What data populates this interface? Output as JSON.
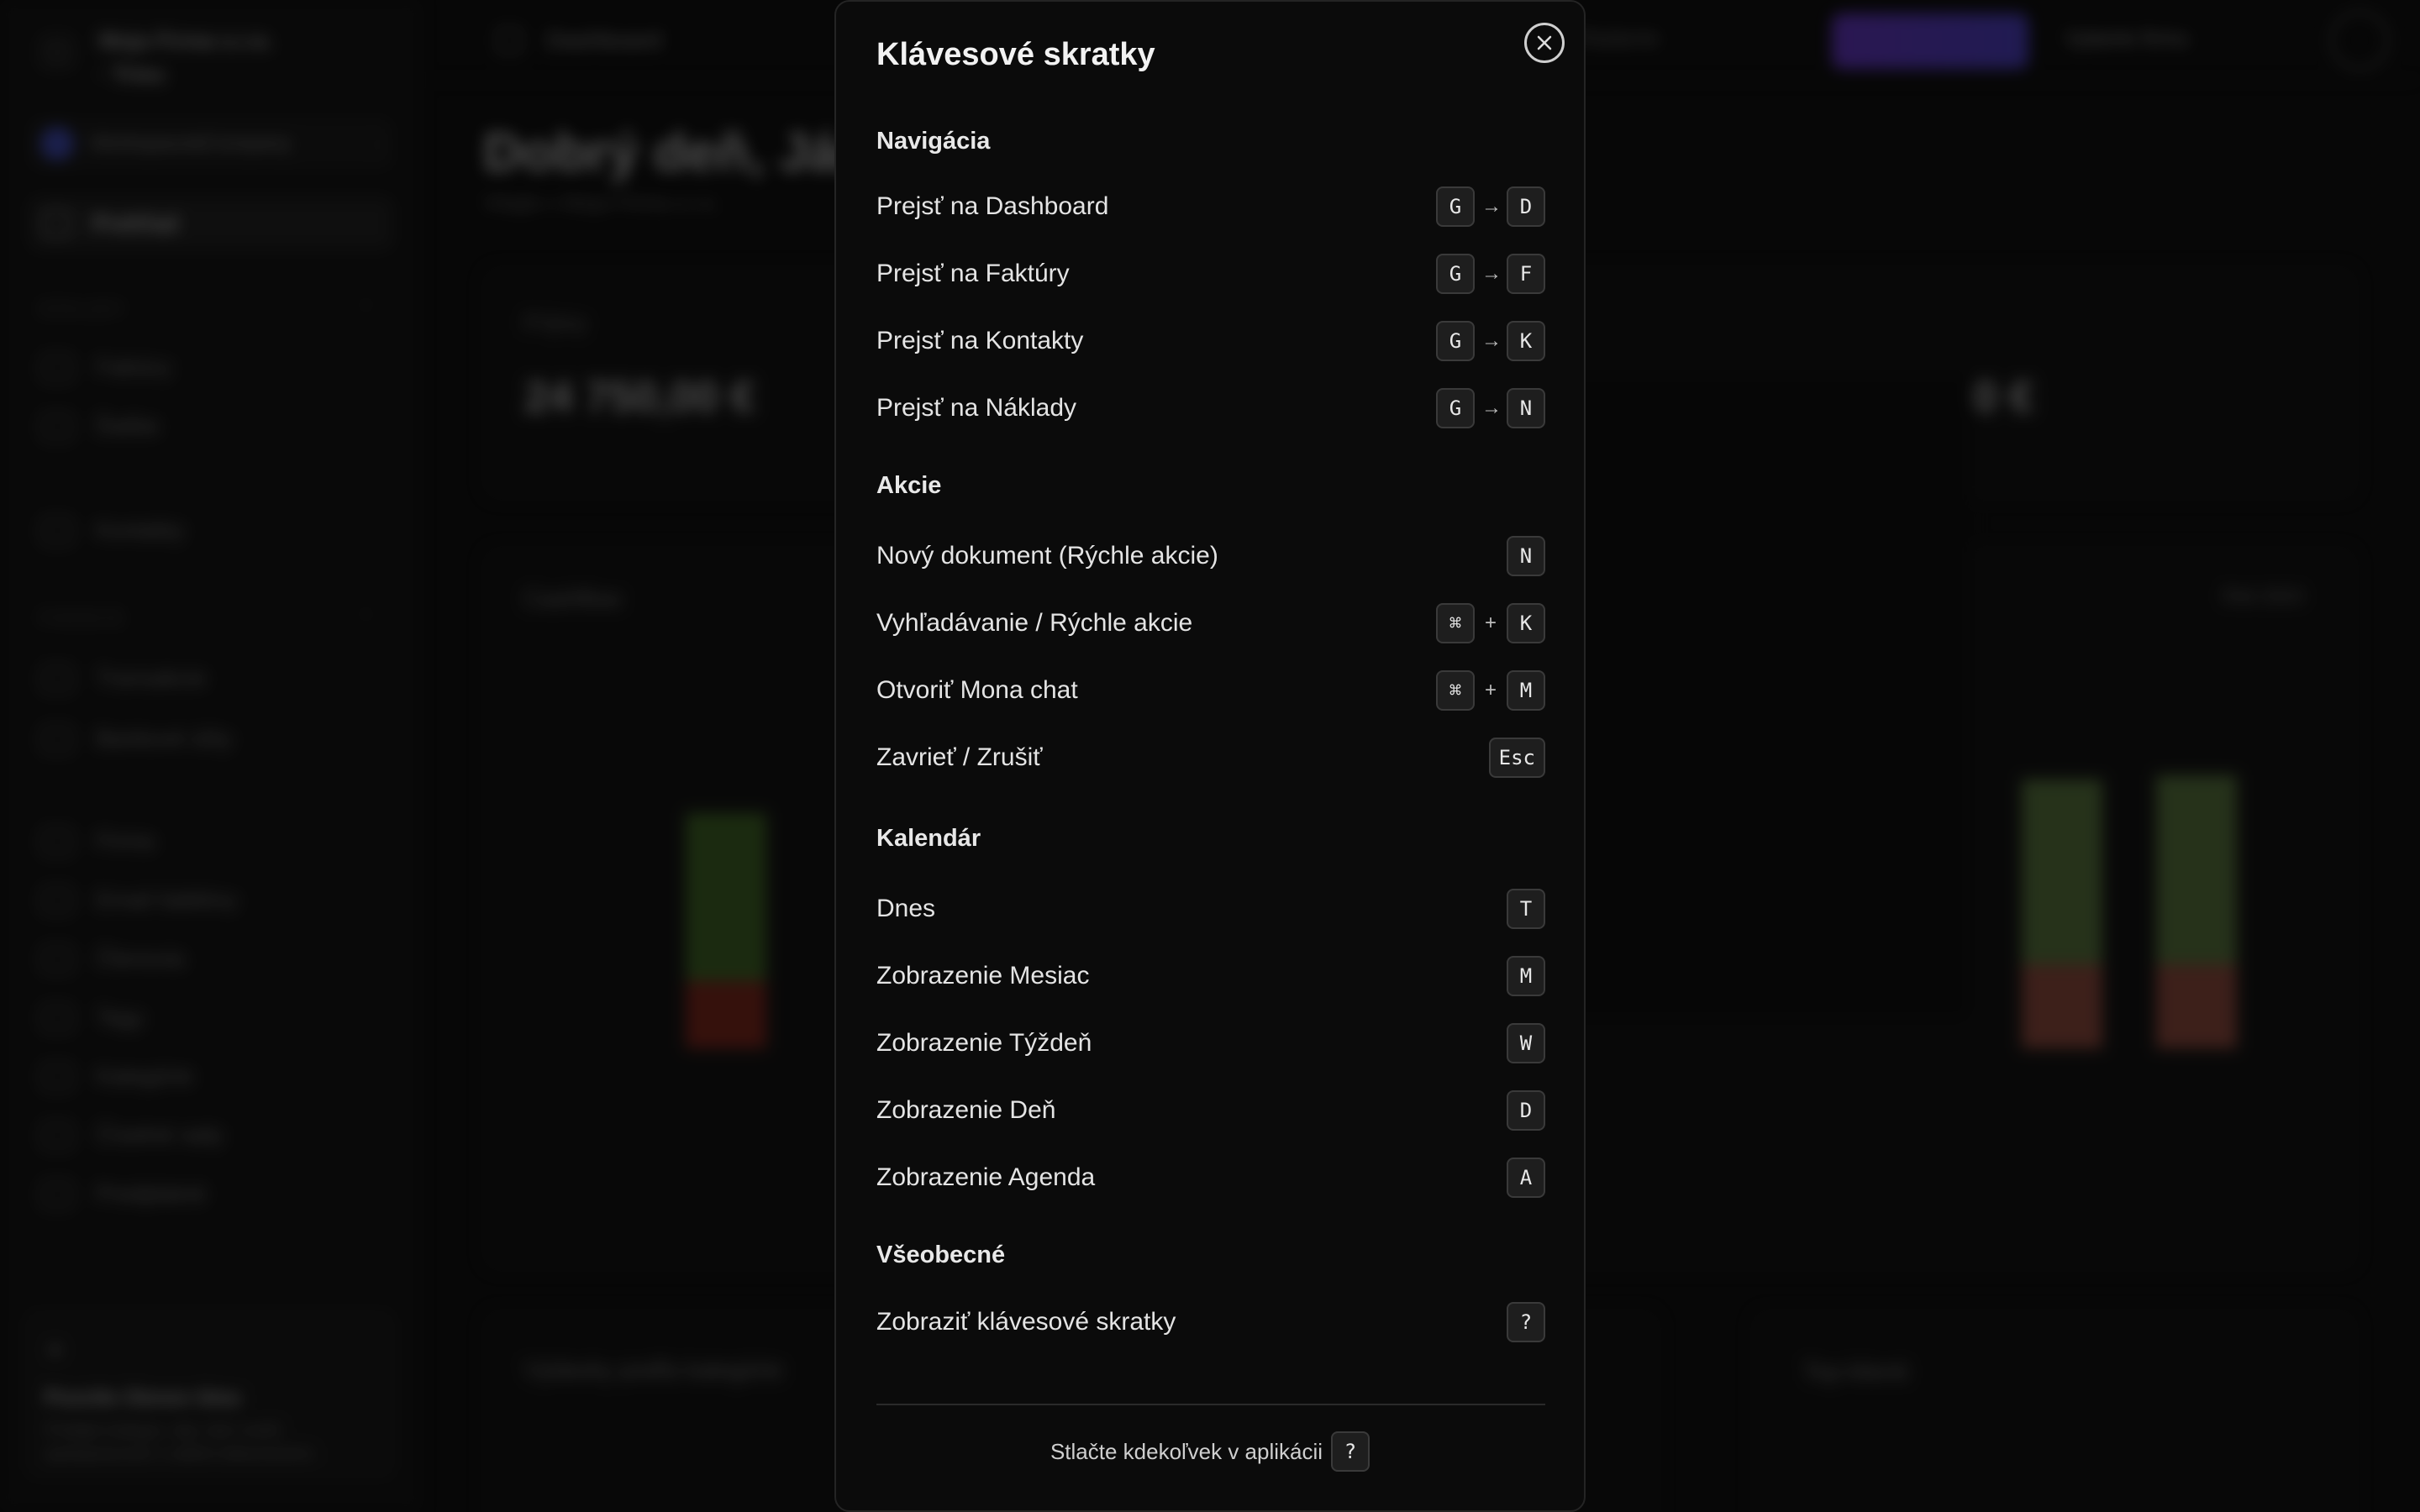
{
  "background": {
    "sidebar": {
      "company_name": "Moja Firma s.r.o. · Trieu",
      "workspace_label": "Workspace&Company",
      "active_item": "Prehľad",
      "section_1": "DOKLADY",
      "section_1_items": [
        "Faktúry",
        "Ďalšie",
        "Kontakty"
      ],
      "section_2": "FINANCIE",
      "section_2_items": [
        "Transakcie",
        "Bankové účty",
        "Firma",
        "Email šablóny",
        "Členovia",
        "Tagy",
        "Kategórie",
        "Číselné rady",
        "Predplatné"
      ],
      "tip_title": "Pozvite členov tímu",
      "tip_text": "Pridajte kolegov, aby vám mohli spolupracovať s vašimi dokumentmi."
    },
    "topbar": {
      "title": "Dashboard",
      "search": "Hľadanie",
      "shortcut_hint": "⌘K",
      "new_label": "Nový",
      "link": "Vyberte firmu"
    },
    "greeting": "Dobrý deň, Ján",
    "greeting_sub": "Vitajte v Moja Firma s.r.o.",
    "kpi": {
      "label": "Príjmy",
      "value": "24 750,00 €",
      "value2": "3,00 €"
    },
    "chart_title": "Cashflow",
    "chart_range": "Rok 2024",
    "bottom_card_title": "Výdavky podľa kategórie",
    "top_clients_title": "Top klienti"
  },
  "modal": {
    "title": "Klávesové skratky",
    "sections": [
      {
        "title": "Navigácia",
        "shortcuts": [
          {
            "label": "Prejsť na Dashboard",
            "keys": [
              "G",
              "D"
            ],
            "sep": "→"
          },
          {
            "label": "Prejsť na Faktúry",
            "keys": [
              "G",
              "F"
            ],
            "sep": "→"
          },
          {
            "label": "Prejsť na Kontakty",
            "keys": [
              "G",
              "K"
            ],
            "sep": "→"
          },
          {
            "label": "Prejsť na Náklady",
            "keys": [
              "G",
              "N"
            ],
            "sep": "→"
          }
        ]
      },
      {
        "title": "Akcie",
        "shortcuts": [
          {
            "label": "Nový dokument (Rýchle akcie)",
            "keys": [
              "N"
            ],
            "sep": ""
          },
          {
            "label": "Vyhľadávanie / Rýchle akcie",
            "keys": [
              "⌘",
              "K"
            ],
            "sep": "+"
          },
          {
            "label": "Otvoriť Mona chat",
            "keys": [
              "⌘",
              "M"
            ],
            "sep": "+"
          },
          {
            "label": "Zavrieť / Zrušiť",
            "keys": [
              "Esc"
            ],
            "sep": ""
          }
        ]
      },
      {
        "title": "Kalendár",
        "shortcuts": [
          {
            "label": "Dnes",
            "keys": [
              "T"
            ],
            "sep": ""
          },
          {
            "label": "Zobrazenie Mesiac",
            "keys": [
              "M"
            ],
            "sep": ""
          },
          {
            "label": "Zobrazenie Týždeň",
            "keys": [
              "W"
            ],
            "sep": ""
          },
          {
            "label": "Zobrazenie Deň",
            "keys": [
              "D"
            ],
            "sep": ""
          },
          {
            "label": "Zobrazenie Agenda",
            "keys": [
              "A"
            ],
            "sep": ""
          }
        ]
      },
      {
        "title": "Všeobecné",
        "shortcuts": [
          {
            "label": "Zobraziť klávesové skratky",
            "keys": [
              "?"
            ],
            "sep": ""
          }
        ]
      }
    ],
    "footer_text": "Stlačte kdekoľvek v aplikácii",
    "footer_key": "?"
  },
  "colors": {
    "modal_bg": "#0b0b0b",
    "key_bg": "#1e1e1e",
    "key_border": "#3a3a3a",
    "accent_purple": "#7b3ff2",
    "bar_green": "#4b7a2a",
    "bar_red": "#9b2c1f"
  }
}
